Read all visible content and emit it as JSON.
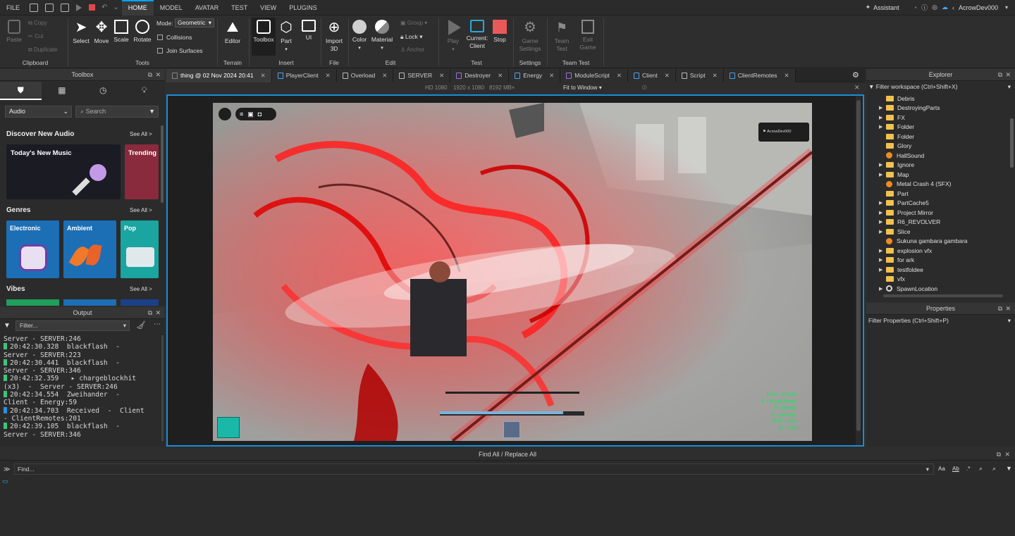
{
  "menubar": {
    "file": "FILE",
    "tabs": [
      "HOME",
      "MODEL",
      "AVATAR",
      "TEST",
      "VIEW",
      "PLUGINS"
    ],
    "assistant": "Assistant",
    "user": "AcrowDev000"
  },
  "ribbon": {
    "clipboard": {
      "paste": "Paste",
      "copy": "Copy",
      "cut": "Cut",
      "duplicate": "Duplicate",
      "group": "Clipboard"
    },
    "tools": {
      "select": "Select",
      "move": "Move",
      "scale": "Scale",
      "rotate": "Rotate",
      "mode_label": "Mode:",
      "mode_value": "Geometric",
      "collisions": "Collisions",
      "join": "Join Surfaces",
      "group": "Tools"
    },
    "terrain": {
      "editor": "Editor",
      "group": "Terrain"
    },
    "insert": {
      "toolbox": "Toolbox",
      "part": "Part",
      "ui": "UI",
      "group": "Insert"
    },
    "file": {
      "import": "Import",
      "import2": "3D",
      "group": "File"
    },
    "edit": {
      "color": "Color",
      "material": "Material",
      "group_btn": "Group",
      "lock": "Lock",
      "anchor": "Anchor",
      "group": "Edit"
    },
    "test": {
      "play": "Play",
      "current": "Current:",
      "client": "Client",
      "stop": "Stop",
      "group": "Test"
    },
    "settings": {
      "game": "Game",
      "settings": "Settings",
      "group": "Settings"
    },
    "teamtest": {
      "team": "Team",
      "test": "Test",
      "exit": "Exit",
      "game": "Game",
      "group": "Team Test"
    }
  },
  "toolbox": {
    "title": "Toolbox",
    "category": "Audio",
    "search_placeholder": "Search",
    "discover": "Discover New Audio",
    "see_all": "See All >",
    "card1": "Today's New Music",
    "card2": "Trending",
    "genres": "Genres",
    "genre_items": [
      "Electronic",
      "Ambient",
      "Pop"
    ],
    "vibes": "Vibes"
  },
  "output": {
    "title": "Output",
    "filter_placeholder": "Filter...",
    "lines": [
      {
        "text": "Server - SERVER:246",
        "color": ""
      },
      {
        "text": "20:42:30.328  blackflash  -",
        "color": "#3fc47a"
      },
      {
        "text": "Server - SERVER:223",
        "color": ""
      },
      {
        "text": "20:42:30.441  blackflash  -",
        "color": "#3fc47a"
      },
      {
        "text": "Server - SERVER:346",
        "color": ""
      },
      {
        "text": "20:42:32.359   ▸ chargeblockhit",
        "color": "#3fc47a"
      },
      {
        "text": "(x3)  -  Server - SERVER:246",
        "color": ""
      },
      {
        "text": "20:42:34.554  Zweihander  -",
        "color": "#3fc47a"
      },
      {
        "text": "Client - Energy:59",
        "color": ""
      },
      {
        "text": "20:42:34.703  Received  -  Client",
        "color": "#2d8fe0"
      },
      {
        "text": "- ClientRemotes:201",
        "color": ""
      },
      {
        "text": "20:42:39.105  blackflash  -",
        "color": "#3fc47a"
      },
      {
        "text": "Server - SERVER:346",
        "color": ""
      }
    ]
  },
  "tabs": [
    {
      "label": "thing @ 02 Nov 2024 20:41",
      "color": ""
    },
    {
      "label": "PlayerClient",
      "color": "#4aa3f0"
    },
    {
      "label": "Overload",
      "color": "#bbbbbb"
    },
    {
      "label": "SERVER",
      "color": "#bbbbbb"
    },
    {
      "label": "Destroyer",
      "color": "#a070e0"
    },
    {
      "label": "Energy",
      "color": "#4aa3f0"
    },
    {
      "label": "ModuleScript",
      "color": "#a070e0"
    },
    {
      "label": "Client",
      "color": "#4aa3f0"
    },
    {
      "label": "Script",
      "color": "#bbbbbb"
    },
    {
      "label": "ClientRemotes",
      "color": "#4aa3f0"
    }
  ],
  "viewport": {
    "hd": "HD 1080",
    "res": "1920 x 1080",
    "mem": "8192 MB",
    "fit": "Fit to Window"
  },
  "game": {
    "player_tag": "AcrowDev000",
    "controls": [
      "Lmb - Attack",
      "F - Block/Parry",
      "R - Heavy",
      "E - Emotes",
      "Shift - Run",
      "Q - Roll"
    ]
  },
  "explorer": {
    "title": "Explorer",
    "filter_placeholder": "Filter workspace (Ctrl+Shift+X)",
    "items": [
      {
        "label": "Debris",
        "icon": "folder",
        "expand": false
      },
      {
        "label": "DestroyingParts",
        "icon": "folder",
        "expand": true
      },
      {
        "label": "FX",
        "icon": "folder",
        "expand": true
      },
      {
        "label": "Folder",
        "icon": "folder",
        "expand": true
      },
      {
        "label": "Folder",
        "icon": "folder",
        "expand": false
      },
      {
        "label": "Glory",
        "icon": "folder",
        "expand": false
      },
      {
        "label": "HallSound",
        "icon": "sound",
        "expand": false
      },
      {
        "label": "Ignore",
        "icon": "folder",
        "expand": true
      },
      {
        "label": "Map",
        "icon": "folder",
        "expand": true
      },
      {
        "label": "Metal Crash 4 (SFX)",
        "icon": "sound",
        "expand": false
      },
      {
        "label": "Part",
        "icon": "folder",
        "expand": false
      },
      {
        "label": "PartCache5",
        "icon": "folder",
        "expand": true
      },
      {
        "label": "Project Mirror",
        "icon": "folder",
        "expand": true
      },
      {
        "label": "R6_REVOLVER",
        "icon": "folder",
        "expand": true
      },
      {
        "label": "Slice",
        "icon": "folder",
        "expand": true
      },
      {
        "label": "Sukuna gambara gambara",
        "icon": "sound",
        "expand": false
      },
      {
        "label": "explosion vfx",
        "icon": "folder",
        "expand": true
      },
      {
        "label": "for ark",
        "icon": "folder",
        "expand": true
      },
      {
        "label": "testfoldee",
        "icon": "folder",
        "expand": true
      },
      {
        "label": "vfx",
        "icon": "folder",
        "expand": false
      },
      {
        "label": "SpawnLocation",
        "icon": "gear",
        "expand": true
      }
    ]
  },
  "properties": {
    "title": "Properties",
    "filter_placeholder": "Filter Properties (Ctrl+Shift+P)"
  },
  "findbar": {
    "title": "Find All / Replace All",
    "find_placeholder": "Find..."
  }
}
